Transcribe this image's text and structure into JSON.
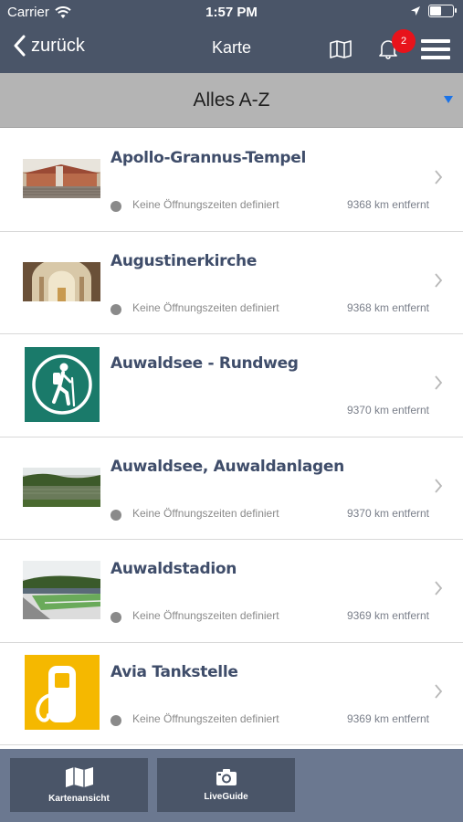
{
  "status_bar": {
    "carrier": "Carrier",
    "time": "1:57 PM",
    "battery_level": 0.5
  },
  "nav": {
    "back_label": "zurück",
    "title": "Karte",
    "notification_count": "2"
  },
  "filter": {
    "label": "Alles A-Z"
  },
  "items": [
    {
      "title": "Apollo-Grannus-Tempel",
      "hours": "Keine Öffnungszeiten definiert",
      "distance": "9368 km entfernt"
    },
    {
      "title": "Augustinerkirche",
      "hours": "Keine Öffnungszeiten definiert",
      "distance": "9368 km entfernt"
    },
    {
      "title": "Auwaldsee - Rundweg",
      "hours": "",
      "distance": "9370 km entfernt"
    },
    {
      "title": "Auwaldsee, Auwaldanlagen",
      "hours": "Keine Öffnungszeiten definiert",
      "distance": "9370 km entfernt"
    },
    {
      "title": "Auwaldstadion",
      "hours": "Keine Öffnungszeiten definiert",
      "distance": "9369 km entfernt"
    },
    {
      "title": "Avia Tankstelle",
      "hours": "Keine Öffnungszeiten definiert",
      "distance": "9369 km entfernt"
    }
  ],
  "tabs": [
    {
      "label": "Kartenansicht",
      "icon": "map-icon"
    },
    {
      "label": "LiveGuide",
      "icon": "camera-icon"
    }
  ],
  "colors": {
    "nav_bg": "#4a5568",
    "filter_bg": "#b4b4b4",
    "badge": "#e8131b",
    "hiking_green": "#1a7a6a",
    "fuel_yellow": "#f5b800"
  }
}
